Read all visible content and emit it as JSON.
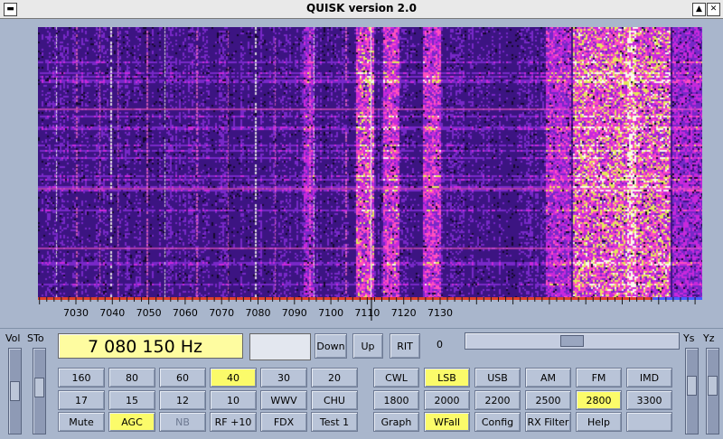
{
  "window": {
    "title": "QUISK version 2.0"
  },
  "axis": {
    "ticks": [
      "7030",
      "7040",
      "7050",
      "7060",
      "7070",
      "7080",
      "7090",
      "7100",
      "7110",
      "7120",
      "7130"
    ]
  },
  "frequency_display": "7 080 150 Hz",
  "tune": {
    "down_label": "Down",
    "up_label": "Up",
    "rit_label": "RIT",
    "rit_value": "0"
  },
  "side_labels": {
    "vol": "Vol",
    "sto": "STo",
    "ys": "Ys",
    "yz": "Yz"
  },
  "sliders": {
    "vol": 0.5,
    "sto": 0.45,
    "ys": 0.42,
    "yz": 0.42,
    "rit_position": 0.5
  },
  "band_buttons": [
    [
      {
        "label": "160",
        "on": false
      },
      {
        "label": "80",
        "on": false
      },
      {
        "label": "60",
        "on": false
      },
      {
        "label": "40",
        "on": true
      },
      {
        "label": "30",
        "on": false
      },
      {
        "label": "20",
        "on": false
      }
    ],
    [
      {
        "label": "17",
        "on": false
      },
      {
        "label": "15",
        "on": false
      },
      {
        "label": "12",
        "on": false
      },
      {
        "label": "10",
        "on": false
      },
      {
        "label": "WWV",
        "on": false
      },
      {
        "label": "CHU",
        "on": false
      }
    ],
    [
      {
        "label": "Mute",
        "on": false
      },
      {
        "label": "AGC",
        "on": true
      },
      {
        "label": "NB",
        "on": false,
        "dim": true
      },
      {
        "label": "RF +10",
        "on": false
      },
      {
        "label": "FDX",
        "on": false
      },
      {
        "label": "Test 1",
        "on": false
      }
    ]
  ],
  "mode_buttons": [
    [
      {
        "label": "CWL",
        "on": false
      },
      {
        "label": "LSB",
        "on": true
      },
      {
        "label": "USB",
        "on": false
      },
      {
        "label": "AM",
        "on": false
      },
      {
        "label": "FM",
        "on": false
      },
      {
        "label": "IMD",
        "on": false
      }
    ],
    [
      {
        "label": "1800",
        "on": false
      },
      {
        "label": "2000",
        "on": false
      },
      {
        "label": "2200",
        "on": false
      },
      {
        "label": "2500",
        "on": false
      },
      {
        "label": "2800",
        "on": true
      },
      {
        "label": "3300",
        "on": false
      }
    ],
    [
      {
        "label": "Graph",
        "on": false
      },
      {
        "label": "WFall",
        "on": true
      },
      {
        "label": "Config",
        "on": false
      },
      {
        "label": "RX Filter",
        "on": false
      },
      {
        "label": "Help",
        "on": false
      },
      {
        "label": "",
        "on": false
      }
    ]
  ],
  "colors": {
    "waterfall_bg": "#1a0a3a",
    "active_button": "#fbfb6a",
    "display_bg": "#fefca0"
  }
}
